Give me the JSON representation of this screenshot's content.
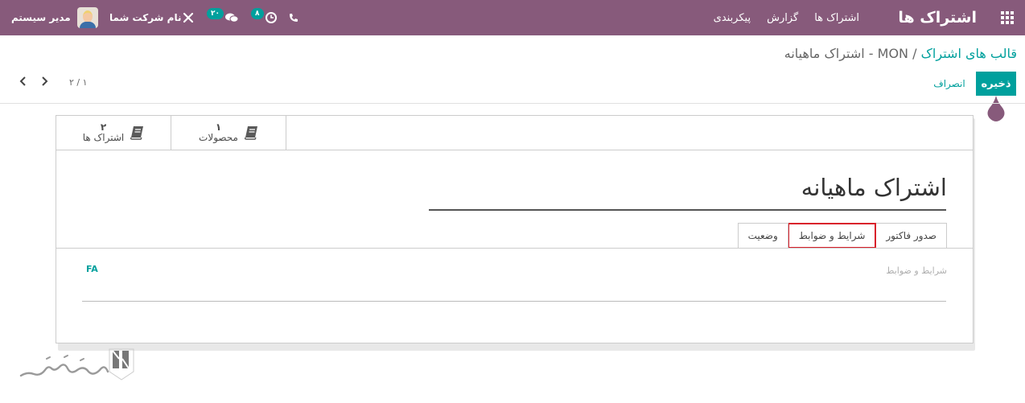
{
  "navbar": {
    "brand": "اشتراک ها",
    "menu": [
      "اشتراک ها",
      "گزارش",
      "پیکربندی"
    ],
    "user_name": "مدیر سیستم",
    "company_name": "نام شرکت شما",
    "messages_badge": "۲۰",
    "activities_badge": "۸"
  },
  "breadcrumb": {
    "parent": "قالب های اشتراک",
    "separator": "/",
    "current": "MON - اشتراک ماهیانه"
  },
  "actions": {
    "save_label": "ذخیره",
    "discard_label": "انصراف"
  },
  "pager": {
    "value": "۱ / ۲"
  },
  "smart_buttons": [
    {
      "label": "محصولات",
      "value": "۱"
    },
    {
      "label": "اشتراک ها",
      "value": "۲"
    }
  ],
  "form": {
    "title": "اشتراک ماهیانه",
    "tabs": [
      "صدور فاکتور",
      "شرایط و ضوابط",
      "وضعیت"
    ],
    "active_tab": "شرایط و ضوابط",
    "terms_placeholder": "شرایط و ضوابط",
    "lang_button": "FA"
  },
  "colors": {
    "navbar": "#875a7b",
    "accent": "#00a09d",
    "highlight": "#d9212b"
  }
}
